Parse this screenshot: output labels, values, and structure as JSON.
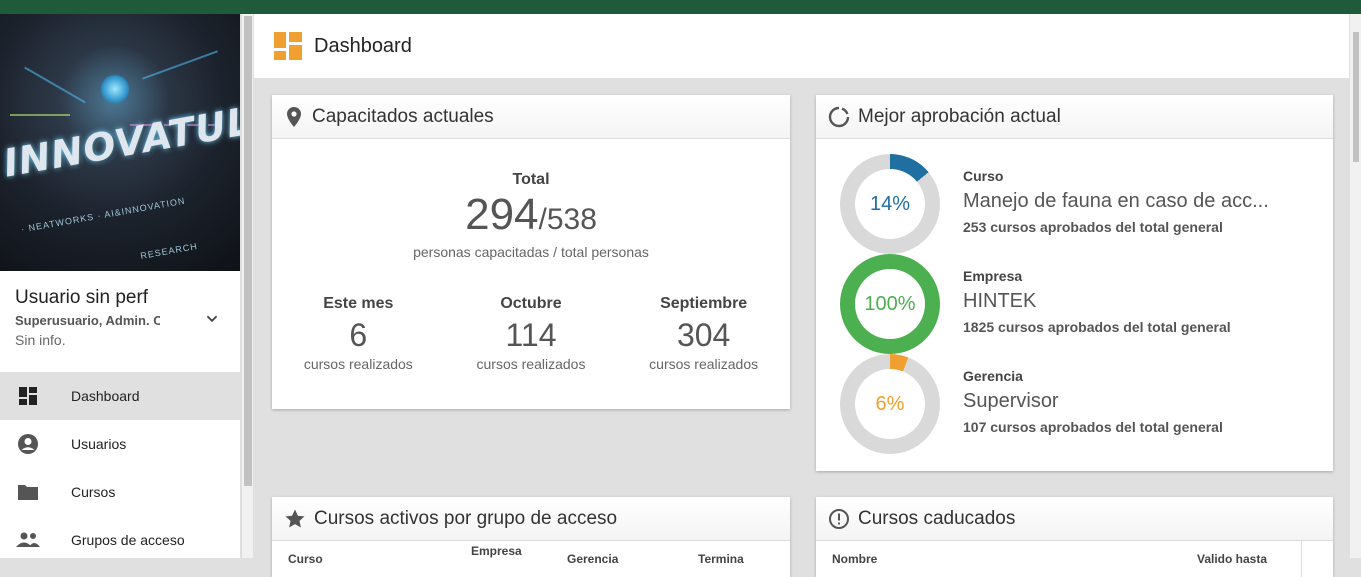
{
  "app": {
    "accent": "#1f5b3a",
    "logo_text": "INNOVATULS",
    "logo_sub": "· NEATWORKS · AI&INNOVATION",
    "logo_research": "RESEARCH"
  },
  "user": {
    "name": "Usuario sin perf",
    "role": "Superusuario, Admin. C",
    "info": "Sin info."
  },
  "nav": {
    "items": [
      {
        "label": "Dashboard",
        "icon": "dashboard-icon",
        "active": true
      },
      {
        "label": "Usuarios",
        "icon": "account-circle-icon",
        "active": false
      },
      {
        "label": "Cursos",
        "icon": "folder-icon",
        "active": false
      },
      {
        "label": "Grupos de acceso",
        "icon": "people-icon",
        "active": false
      }
    ]
  },
  "header": {
    "title": "Dashboard",
    "icon": "dashboard-tiles-icon"
  },
  "capacitados": {
    "title": "Capacitados actuales",
    "icon": "location-pin-icon",
    "total_label": "Total",
    "trained": "294",
    "total": "/538",
    "caption": "personas capacitadas / total personas",
    "periods": [
      {
        "label": "Este mes",
        "value": "6",
        "caption": "cursos realizados"
      },
      {
        "label": "Octubre",
        "value": "114",
        "caption": "cursos realizados"
      },
      {
        "label": "Septiembre",
        "value": "304",
        "caption": "cursos realizados"
      }
    ]
  },
  "aprobacion": {
    "title": "Mejor aprobación actual",
    "icon": "loading-circle-icon",
    "items": [
      {
        "key": "Curso",
        "value": "Manejo de fauna en caso de acc...",
        "note": "253 cursos aprobados del total general",
        "percent_label": "14%",
        "percent": 14,
        "color": "#1f6fa0"
      },
      {
        "key": "Empresa",
        "value": "HINTEK",
        "note": "1825 cursos aprobados del total general",
        "percent_label": "100%",
        "percent": 100,
        "color": "#4caf50"
      },
      {
        "key": "Gerencia",
        "value": "Supervisor",
        "note": "107 cursos aprobados del total general",
        "percent_label": "6%",
        "percent": 6,
        "color": "#f0a030"
      }
    ]
  },
  "cursos_activos": {
    "title": "Cursos activos por grupo de acceso",
    "icon": "star-icon",
    "columns": [
      "Curso",
      "Empresa",
      "Gerencia",
      "Termina"
    ]
  },
  "cursos_caducados": {
    "title": "Cursos caducados",
    "icon": "alert-circle-icon",
    "columns": [
      "Nombre",
      "Valido hasta"
    ]
  }
}
